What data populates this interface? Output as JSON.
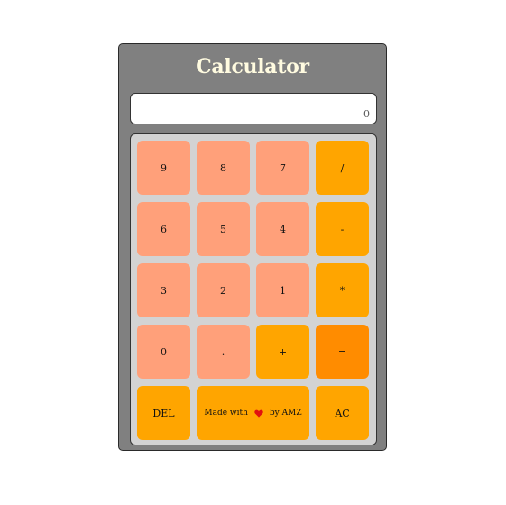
{
  "app": {
    "title": "Calculator"
  },
  "display": {
    "value": "0"
  },
  "keypad": {
    "keys": [
      {
        "label": "9",
        "kind": "num"
      },
      {
        "label": "8",
        "kind": "num"
      },
      {
        "label": "7",
        "kind": "num"
      },
      {
        "label": "/",
        "kind": "op"
      },
      {
        "label": "6",
        "kind": "num"
      },
      {
        "label": "5",
        "kind": "num"
      },
      {
        "label": "4",
        "kind": "num"
      },
      {
        "label": "-",
        "kind": "op"
      },
      {
        "label": "3",
        "kind": "num"
      },
      {
        "label": "2",
        "kind": "num"
      },
      {
        "label": "1",
        "kind": "num"
      },
      {
        "label": "*",
        "kind": "op"
      },
      {
        "label": "0",
        "kind": "num"
      },
      {
        "label": ".",
        "kind": "num"
      },
      {
        "label": "+",
        "kind": "op"
      },
      {
        "label": "=",
        "kind": "eq"
      }
    ],
    "del_label": "DEL",
    "ac_label": "AC",
    "credit": {
      "prefix": "Made with",
      "icon": "heart-icon",
      "suffix": "by AMZ"
    }
  },
  "colors": {
    "frame": "#808080",
    "title": "#fffbe0",
    "keypad_bg": "#d3d3d3",
    "number_key": "#ffa07a",
    "operator_key": "#ffa500",
    "equals_key": "#ff8c00",
    "heart": "#e01010"
  }
}
